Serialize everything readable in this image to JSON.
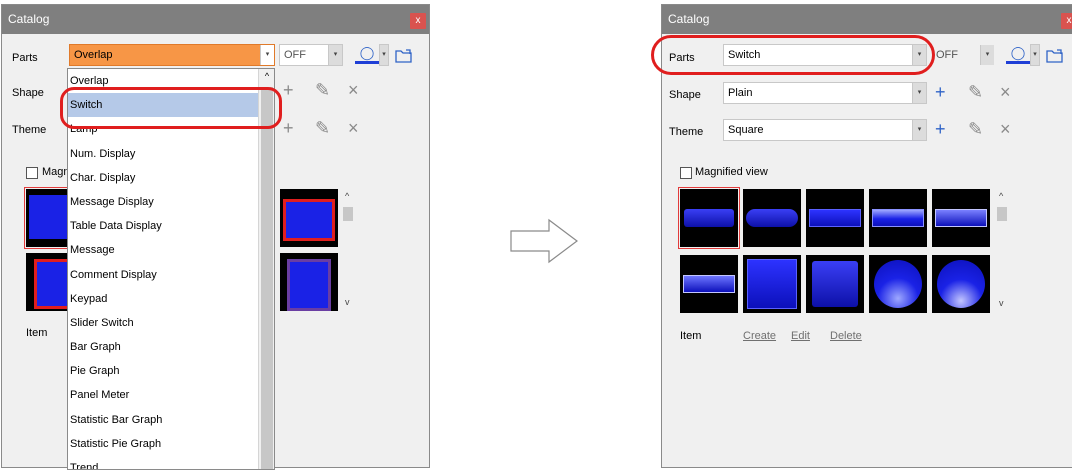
{
  "left_panel": {
    "title": "Catalog",
    "close_label": "x",
    "parts_label": "Parts",
    "parts_value": "Overlap",
    "off_value": "OFF",
    "shape_label": "Shape",
    "theme_label": "Theme",
    "magnified_label": "Magnif",
    "item_label": "Item",
    "dropdown_items": [
      "Overlap",
      "Switch",
      "Lamp",
      "Num. Display",
      "Char. Display",
      "Message Display",
      "Table Data Display",
      "Message",
      "Comment Display",
      "Keypad",
      "Slider Switch",
      "Bar Graph",
      "Pie Graph",
      "Panel Meter",
      "Statistic Bar Graph",
      "Statistic Pie Graph",
      "Trend"
    ],
    "selected_item": "Switch"
  },
  "right_panel": {
    "title": "Catalog",
    "parts_label": "Parts",
    "parts_value": "Switch",
    "off_value": "OFF",
    "shape_label": "Shape",
    "shape_value": "Plain",
    "theme_label": "Theme",
    "theme_value": "Square",
    "magnified_label": "Magnified view",
    "item_label": "Item",
    "create_label": "Create",
    "edit_label": "Edit",
    "delete_label": "Delete"
  },
  "icons": {
    "add": "+",
    "edit": "✎",
    "delete": "×",
    "scroll_up": "^",
    "scroll_down": "v",
    "dropdown": "▾"
  },
  "colors": {
    "title_bar": "#7f7f7f",
    "close_button": "#d9534f",
    "highlight_ring": "#e01e1e",
    "orange_combo": "#f79646",
    "selection": "#b5c9e8",
    "switch_blue": "#1a22e6"
  }
}
